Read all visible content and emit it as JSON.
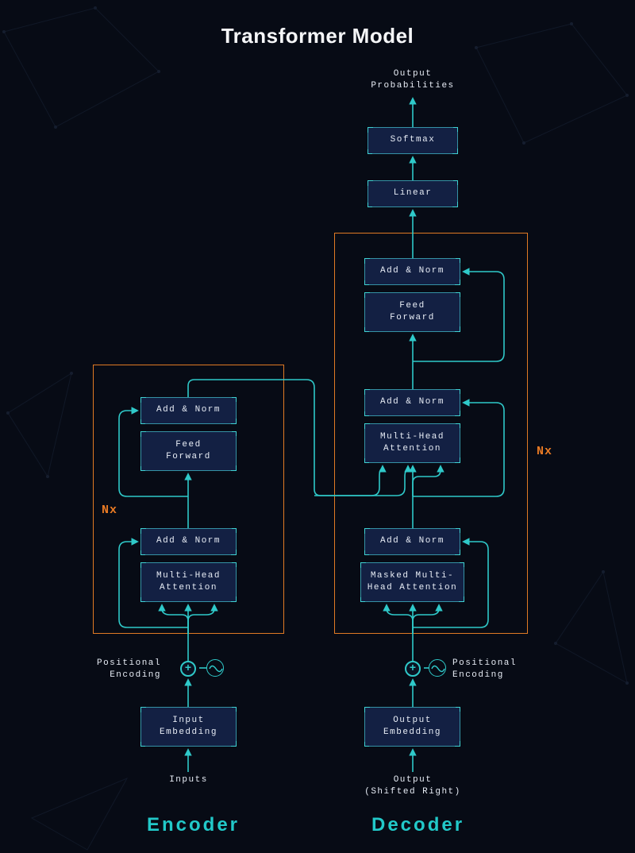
{
  "title": "Transformer Model",
  "output_label": "Output\nProbabilities",
  "top": {
    "softmax": "Softmax",
    "linear": "Linear"
  },
  "encoder": {
    "title": "Encoder",
    "nx": "Nx",
    "add_norm_top": "Add & Norm",
    "feed_forward": "Feed\nForward",
    "add_norm_bottom": "Add & Norm",
    "multi_head": "Multi-Head\nAttention",
    "positional": "Positional\nEncoding",
    "embedding": "Input\nEmbedding",
    "inputs": "Inputs"
  },
  "decoder": {
    "title": "Decoder",
    "nx": "Nx",
    "add_norm_1": "Add & Norm",
    "feed_forward": "Feed\nForward",
    "add_norm_2": "Add & Norm",
    "multi_head": "Multi-Head\nAttention",
    "add_norm_3": "Add & Norm",
    "masked_multi_head": "Masked Multi-\nHead Attention",
    "positional": "Positional\nEncoding",
    "embedding": "Output\nEmbedding",
    "outputs": "Output\n(Shifted Right)"
  },
  "colors": {
    "accent": "#2fc9c9",
    "orange": "#e07a24",
    "block_bg": "#132043",
    "block_border": "#3592a5",
    "text": "#e7ecf5"
  }
}
